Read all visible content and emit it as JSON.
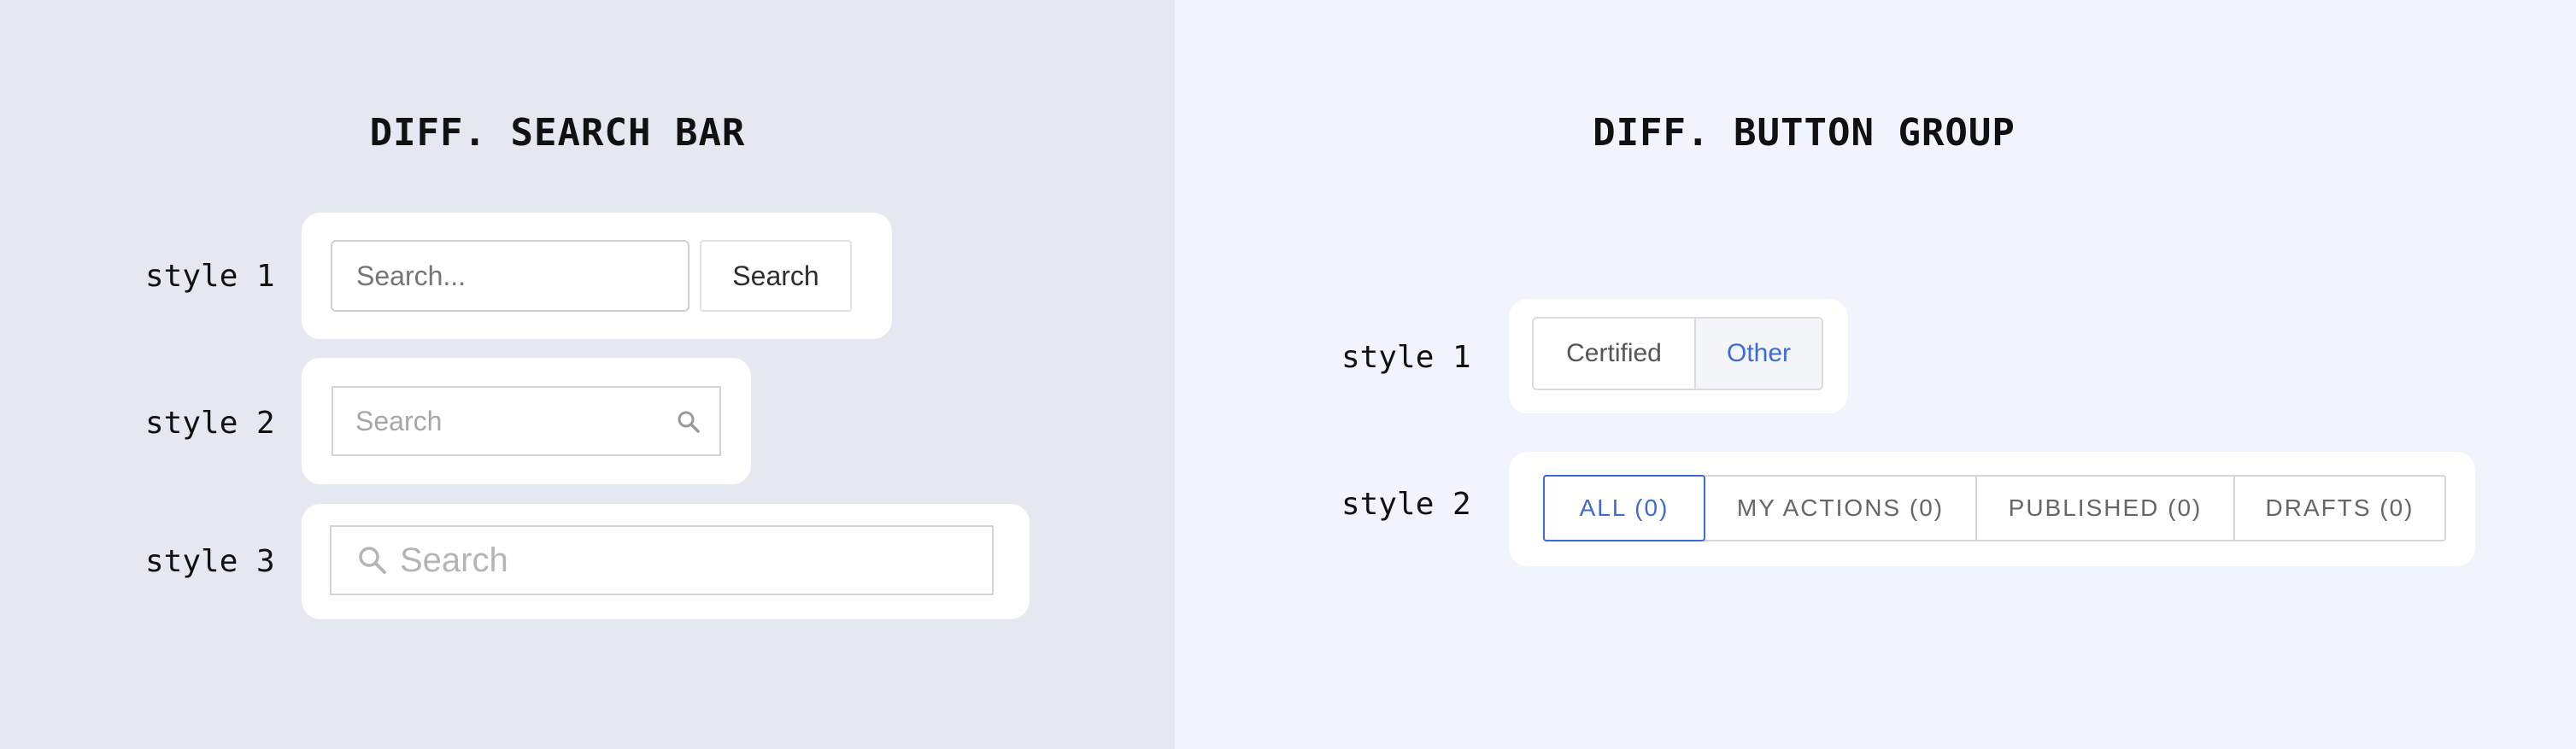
{
  "search_panel": {
    "title": "DIFF. SEARCH BAR",
    "style1": {
      "label": "style 1",
      "placeholder": "Search...",
      "button_label": "Search"
    },
    "style2": {
      "label": "style 2",
      "placeholder": "Search",
      "icon": "search-icon"
    },
    "style3": {
      "label": "style 3",
      "placeholder": "Search",
      "icon": "search-icon"
    }
  },
  "button_group_panel": {
    "title": "DIFF. BUTTON GROUP",
    "style1": {
      "label": "style 1",
      "buttons": [
        {
          "label": "Certified",
          "active": false
        },
        {
          "label": "Other",
          "active": true
        }
      ]
    },
    "style2": {
      "label": "style 2",
      "buttons": [
        {
          "label": "ALL (0)",
          "active": true
        },
        {
          "label": "MY ACTIONS (0)",
          "active": false
        },
        {
          "label": "PUBLISHED (0)",
          "active": false
        },
        {
          "label": "DRAFTS (0)",
          "active": false
        }
      ]
    }
  },
  "colors": {
    "left_background": "#e6e8f1",
    "right_background": "#f1f4fd",
    "accent_blue": "#3d6ad6",
    "card": "#ffffff"
  }
}
